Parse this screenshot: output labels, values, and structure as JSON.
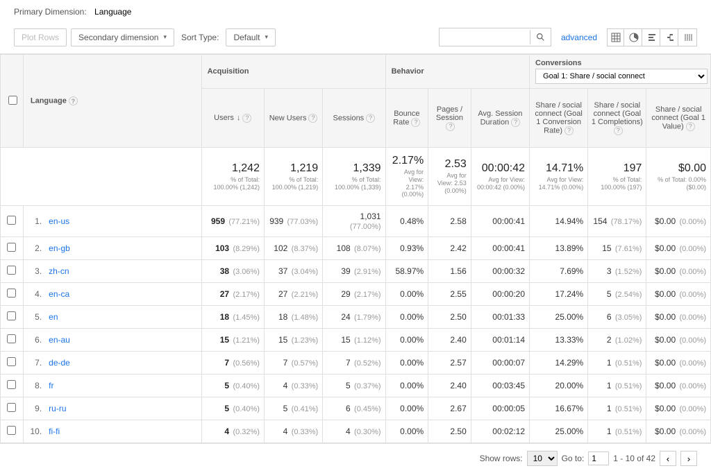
{
  "topbar": {
    "primary_dimension_label": "Primary Dimension:",
    "primary_dimension_value": "Language"
  },
  "controls": {
    "plot_rows": "Plot Rows",
    "secondary_dimension": "Secondary dimension",
    "sort_type_label": "Sort Type:",
    "sort_type_value": "Default",
    "advanced": "advanced"
  },
  "headers": {
    "language": "Language",
    "acquisition": "Acquisition",
    "behavior": "Behavior",
    "conversions": "Conversions",
    "goal_selected": "Goal 1: Share / social connect",
    "users": "Users",
    "new_users": "New Users",
    "sessions": "Sessions",
    "bounce_rate": "Bounce Rate",
    "pages_session": "Pages / Session",
    "avg_session": "Avg. Session Duration",
    "goal_conv": "Share / social connect (Goal 1 Conversion Rate)",
    "goal_comp": "Share / social connect (Goal 1 Completions)",
    "goal_value": "Share / social connect (Goal 1 Value)"
  },
  "summary": {
    "users": {
      "val": "1,242",
      "sub": "% of Total: 100.00% (1,242)"
    },
    "new_users": {
      "val": "1,219",
      "sub": "% of Total: 100.00% (1,219)"
    },
    "sessions": {
      "val": "1,339",
      "sub": "% of Total: 100.00% (1,339)"
    },
    "bounce": {
      "val": "2.17%",
      "sub": "Avg for View: 2.17% (0.00%)"
    },
    "pages": {
      "val": "2.53",
      "sub": "Avg for View: 2.53 (0.00%)"
    },
    "duration": {
      "val": "00:00:42",
      "sub": "Avg for View: 00:00:42 (0.00%)"
    },
    "conv": {
      "val": "14.71%",
      "sub": "Avg for View: 14.71% (0.00%)"
    },
    "comp": {
      "val": "197",
      "sub": "% of Total: 100.00% (197)"
    },
    "value": {
      "val": "$0.00",
      "sub": "% of Total: 0.00% ($0.00)"
    }
  },
  "rows": [
    {
      "idx": "1.",
      "lang": "en-us",
      "users": "959",
      "users_p": "(77.21%)",
      "nu": "939",
      "nu_p": "(77.03%)",
      "s": "1,031",
      "s_p": "(77.00%)",
      "br": "0.48%",
      "ps": "2.58",
      "dur": "00:00:41",
      "cr": "14.94%",
      "cm": "154",
      "cm_p": "(78.17%)",
      "gv": "$0.00",
      "gv_p": "(0.00%)"
    },
    {
      "idx": "2.",
      "lang": "en-gb",
      "users": "103",
      "users_p": "(8.29%)",
      "nu": "102",
      "nu_p": "(8.37%)",
      "s": "108",
      "s_p": "(8.07%)",
      "br": "0.93%",
      "ps": "2.42",
      "dur": "00:00:41",
      "cr": "13.89%",
      "cm": "15",
      "cm_p": "(7.61%)",
      "gv": "$0.00",
      "gv_p": "(0.00%)"
    },
    {
      "idx": "3.",
      "lang": "zh-cn",
      "users": "38",
      "users_p": "(3.06%)",
      "nu": "37",
      "nu_p": "(3.04%)",
      "s": "39",
      "s_p": "(2.91%)",
      "br": "58.97%",
      "ps": "1.56",
      "dur": "00:00:32",
      "cr": "7.69%",
      "cm": "3",
      "cm_p": "(1.52%)",
      "gv": "$0.00",
      "gv_p": "(0.00%)"
    },
    {
      "idx": "4.",
      "lang": "en-ca",
      "users": "27",
      "users_p": "(2.17%)",
      "nu": "27",
      "nu_p": "(2.21%)",
      "s": "29",
      "s_p": "(2.17%)",
      "br": "0.00%",
      "ps": "2.55",
      "dur": "00:00:20",
      "cr": "17.24%",
      "cm": "5",
      "cm_p": "(2.54%)",
      "gv": "$0.00",
      "gv_p": "(0.00%)"
    },
    {
      "idx": "5.",
      "lang": "en",
      "users": "18",
      "users_p": "(1.45%)",
      "nu": "18",
      "nu_p": "(1.48%)",
      "s": "24",
      "s_p": "(1.79%)",
      "br": "0.00%",
      "ps": "2.50",
      "dur": "00:01:33",
      "cr": "25.00%",
      "cm": "6",
      "cm_p": "(3.05%)",
      "gv": "$0.00",
      "gv_p": "(0.00%)"
    },
    {
      "idx": "6.",
      "lang": "en-au",
      "users": "15",
      "users_p": "(1.21%)",
      "nu": "15",
      "nu_p": "(1.23%)",
      "s": "15",
      "s_p": "(1.12%)",
      "br": "0.00%",
      "ps": "2.40",
      "dur": "00:01:14",
      "cr": "13.33%",
      "cm": "2",
      "cm_p": "(1.02%)",
      "gv": "$0.00",
      "gv_p": "(0.00%)"
    },
    {
      "idx": "7.",
      "lang": "de-de",
      "users": "7",
      "users_p": "(0.56%)",
      "nu": "7",
      "nu_p": "(0.57%)",
      "s": "7",
      "s_p": "(0.52%)",
      "br": "0.00%",
      "ps": "2.57",
      "dur": "00:00:07",
      "cr": "14.29%",
      "cm": "1",
      "cm_p": "(0.51%)",
      "gv": "$0.00",
      "gv_p": "(0.00%)"
    },
    {
      "idx": "8.",
      "lang": "fr",
      "users": "5",
      "users_p": "(0.40%)",
      "nu": "4",
      "nu_p": "(0.33%)",
      "s": "5",
      "s_p": "(0.37%)",
      "br": "0.00%",
      "ps": "2.40",
      "dur": "00:03:45",
      "cr": "20.00%",
      "cm": "1",
      "cm_p": "(0.51%)",
      "gv": "$0.00",
      "gv_p": "(0.00%)"
    },
    {
      "idx": "9.",
      "lang": "ru-ru",
      "users": "5",
      "users_p": "(0.40%)",
      "nu": "5",
      "nu_p": "(0.41%)",
      "s": "6",
      "s_p": "(0.45%)",
      "br": "0.00%",
      "ps": "2.67",
      "dur": "00:00:05",
      "cr": "16.67%",
      "cm": "1",
      "cm_p": "(0.51%)",
      "gv": "$0.00",
      "gv_p": "(0.00%)"
    },
    {
      "idx": "10.",
      "lang": "fi-fi",
      "users": "4",
      "users_p": "(0.32%)",
      "nu": "4",
      "nu_p": "(0.33%)",
      "s": "4",
      "s_p": "(0.30%)",
      "br": "0.00%",
      "ps": "2.50",
      "dur": "00:02:12",
      "cr": "25.00%",
      "cm": "1",
      "cm_p": "(0.51%)",
      "gv": "$0.00",
      "gv_p": "(0.00%)"
    }
  ],
  "pager": {
    "show_rows": "Show rows:",
    "rows_value": "10",
    "goto_label": "Go to:",
    "goto_value": "1",
    "range": "1 - 10 of 42"
  }
}
